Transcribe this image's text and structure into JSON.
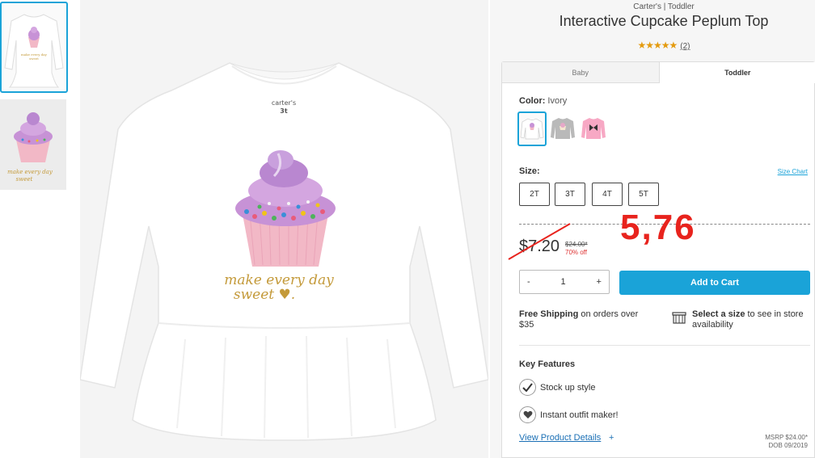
{
  "product": {
    "breadcrumb": "Carter's | Toddler",
    "title": "Interactive Cupcake Peplum Top",
    "rating_stars": "★★★★★",
    "rating_value": 5,
    "review_count": "(2)"
  },
  "tabs": [
    {
      "label": "Baby",
      "active": false
    },
    {
      "label": "Toddler",
      "active": true
    }
  ],
  "color": {
    "label": "Color:",
    "selected": "Ivory",
    "swatches": [
      "Ivory",
      "Gray",
      "Pink"
    ]
  },
  "size": {
    "label": "Size:",
    "chart_link": "Size Chart",
    "options": [
      "2T",
      "3T",
      "4T",
      "5T"
    ]
  },
  "price": {
    "sale": "$7.20",
    "original": "$24.00*",
    "discount": "70% off",
    "annotation": "5,76"
  },
  "quantity": {
    "minus": "-",
    "value": "1",
    "plus": "+"
  },
  "cart_button": "Add to Cart",
  "shipping": {
    "bold": "Free Shipping",
    "text": " on orders over $35"
  },
  "store": {
    "bold": "Select a size",
    "text": " to see in store availability"
  },
  "features": {
    "title": "Key Features",
    "items": [
      "Stock up style",
      "Instant outfit maker!"
    ]
  },
  "details_link": "View Product Details",
  "details_plus": "+",
  "msrp": {
    "line1": "MSRP $24.00*",
    "line2": "DOB 09/2019"
  },
  "shirt_print": {
    "text": "make every day sweet",
    "tag_brand": "carter's",
    "tag_size": "3t"
  },
  "colors": {
    "accent": "#1aa3d8",
    "star": "#e49b0f",
    "annotation": "#e8231d",
    "discount": "#dd3333"
  }
}
